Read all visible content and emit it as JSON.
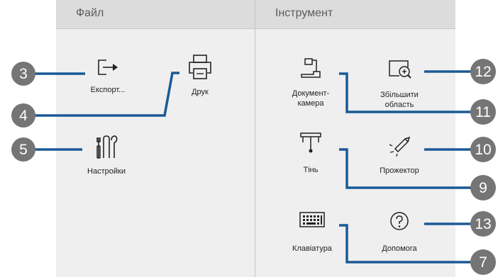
{
  "panels": {
    "file": {
      "title": "Файл"
    },
    "tools": {
      "title": "Інструмент"
    }
  },
  "buttons": {
    "export": {
      "label": "Експорт...",
      "icon": "export-icon"
    },
    "print": {
      "label": "Друк",
      "icon": "printer-icon"
    },
    "settings": {
      "label": "Настройки",
      "icon": "tools-icon"
    },
    "doc_camera": {
      "label_line1": "Документ-",
      "label_line2": "камера",
      "icon": "document-camera-icon"
    },
    "zoom_area": {
      "label_line1": "Збільшити",
      "label_line2": "область",
      "icon": "zoom-area-icon"
    },
    "shade": {
      "label": "Тінь",
      "icon": "shade-icon"
    },
    "spotlight": {
      "label": "Прожектор",
      "icon": "spotlight-icon"
    },
    "keyboard": {
      "label": "Клавіатура",
      "icon": "keyboard-icon"
    },
    "help": {
      "label": "Допомога",
      "icon": "help-icon"
    }
  },
  "callouts": [
    {
      "number": "3"
    },
    {
      "number": "4"
    },
    {
      "number": "5"
    },
    {
      "number": "12"
    },
    {
      "number": "11"
    },
    {
      "number": "10"
    },
    {
      "number": "9"
    },
    {
      "number": "13"
    },
    {
      "number": "7"
    }
  ],
  "colors": {
    "callout_fill": "#757575",
    "leader_line": "#1a5a96",
    "panel_bg": "#efefef",
    "header_bg": "#dcdcdc"
  }
}
